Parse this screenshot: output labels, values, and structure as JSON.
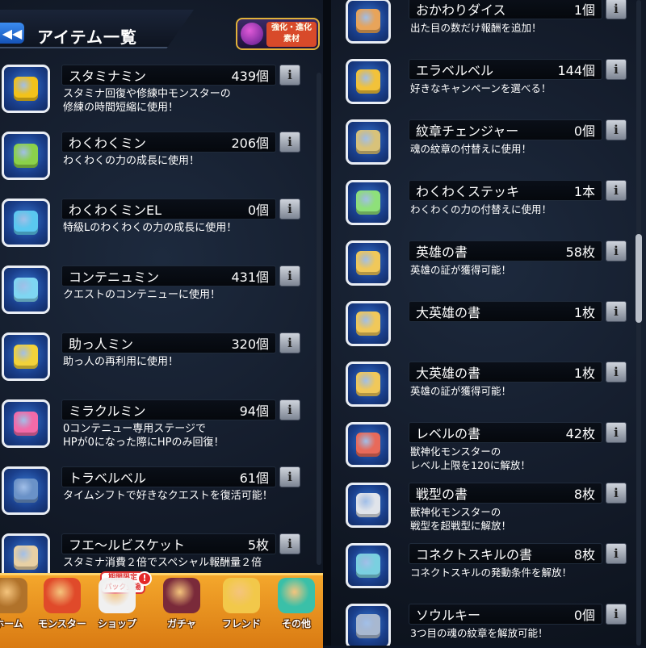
{
  "header": {
    "title": "アイテム一覧",
    "back_icon": "double-left-arrow",
    "evolve_label_line1": "強化・進化",
    "evolve_label_line2": "素材"
  },
  "left_items": [
    {
      "name": "スタミナミン",
      "count": "439個",
      "desc": [
        "スタミナ回復や修練中モンスターの",
        "修練の時間短縮に使用！"
      ],
      "icon": "stamina-can-icon",
      "color": "#f2c21a"
    },
    {
      "name": "わくわくミン",
      "count": "206個",
      "desc": [
        "わくわくの力の成長に使用！"
      ],
      "icon": "sprout-bottle-icon",
      "color": "#8bd14a"
    },
    {
      "name": "わくわくミンEL",
      "count": "0個",
      "desc": [
        "特級Lのわくわくの力の成長に使用！"
      ],
      "icon": "blue-bottle-icon",
      "color": "#5ac8f0"
    },
    {
      "name": "コンテニュミン",
      "count": "431個",
      "desc": [
        "クエストのコンテニューに使用！"
      ],
      "icon": "continue-flask-icon",
      "color": "#7fd6f2"
    },
    {
      "name": "助っ人ミン",
      "count": "320個",
      "desc": [
        "助っ人の再利用に使用！"
      ],
      "icon": "helper-bottle-icon",
      "color": "#f2d23a"
    },
    {
      "name": "ミラクルミン",
      "count": "94個",
      "desc": [
        "0コンテニュー専用ステージで",
        "HPが0になった際にHPのみ回復！"
      ],
      "icon": "heart-potion-icon",
      "color": "#f26aa8"
    },
    {
      "name": "トラベルベル",
      "count": "61個",
      "desc": [
        "タイムシフトで好きなクエストを復活可能！"
      ],
      "icon": "travel-bell-icon",
      "color": "#6a92c8"
    },
    {
      "name": "フエ〜ルビスケット",
      "count": "5枚",
      "desc": [
        "スタミナ消費２倍でスペシャル報酬量２倍"
      ],
      "icon": "biscuit-icon",
      "color": "#e8d0a4"
    }
  ],
  "right_items": [
    {
      "name": "おかわりダイス",
      "count": "1個",
      "desc": [
        "出た目の数だけ報酬を追加！"
      ],
      "icon": "dice-icon",
      "color": "#e8a45a"
    },
    {
      "name": "エラベルベル",
      "count": "144個",
      "desc": [
        "好きなキャンペーンを選べる！"
      ],
      "icon": "gold-bell-icon",
      "color": "#f2c23a"
    },
    {
      "name": "紋章チェンジャー",
      "count": "0個",
      "desc": [
        "魂の紋章の付替えに使用！"
      ],
      "icon": "crest-changer-icon",
      "color": "#d8c27a"
    },
    {
      "name": "わくわくステッキ",
      "count": "1本",
      "desc": [
        "わくわくの力の付替えに使用！"
      ],
      "icon": "magic-wand-icon",
      "color": "#8ee07a"
    },
    {
      "name": "英雄の書",
      "count": "58枚",
      "desc": [
        "英雄の証が獲得可能！"
      ],
      "icon": "hero-scroll-icon",
      "color": "#f0c85a"
    },
    {
      "name": "大英雄の書",
      "count": "1枚",
      "desc": [
        ""
      ],
      "icon": "great-hero-scroll-icon",
      "color": "#f0c85a"
    },
    {
      "name": "大英雄の書",
      "count": "1枚",
      "desc": [
        "英雄の証が獲得可能！"
      ],
      "icon": "great-hero-scroll-icon",
      "color": "#f0c85a"
    },
    {
      "name": "レベルの書",
      "count": "42枚",
      "desc": [
        "獣神化モンスターの",
        "レベル上限を120に解放！"
      ],
      "icon": "level-book-icon",
      "color": "#e86a5a"
    },
    {
      "name": "戦型の書",
      "count": "8枚",
      "desc": [
        "獣神化モンスターの",
        "戦型を超戦型に解放！"
      ],
      "icon": "battle-type-book-icon",
      "color": "#e0e4ea"
    },
    {
      "name": "コネクトスキルの書",
      "count": "8枚",
      "desc": [
        "コネクトスキルの発動条件を解放！"
      ],
      "icon": "connect-skill-book-icon",
      "color": "#7ad0e0"
    },
    {
      "name": "ソウルキー",
      "count": "0個",
      "desc": [
        "3つ目の魂の紋章を解放可能！"
      ],
      "icon": "soul-key-icon",
      "color": "#a8b8d0"
    }
  ],
  "info_label": "i",
  "bottom_nav": {
    "items": [
      {
        "label": "ホーム",
        "icon": "home-icon",
        "color": "#b0722a"
      },
      {
        "label": "モンスター",
        "icon": "monster-icon",
        "color": "#e04a2a"
      },
      {
        "label": "ショップ",
        "icon": "shop-orb-icon",
        "color": "#f0f0f0"
      },
      {
        "label": "ガチャ",
        "icon": "gacha-icon",
        "color": "#7a2a3a"
      },
      {
        "label": "フレンド",
        "icon": "friend-balloons-icon",
        "color": "#f2c84a"
      },
      {
        "label": "その他",
        "icon": "other-icon",
        "color": "#3ac0a8"
      }
    ],
    "promo_line1": "期間限定",
    "promo_line2": "パック登場",
    "alert": "!"
  },
  "colors": {
    "background": "#141c2b",
    "name_bar": "#05080d",
    "icon_frame": "#1a3f8c",
    "nav": "#f4a72c"
  }
}
